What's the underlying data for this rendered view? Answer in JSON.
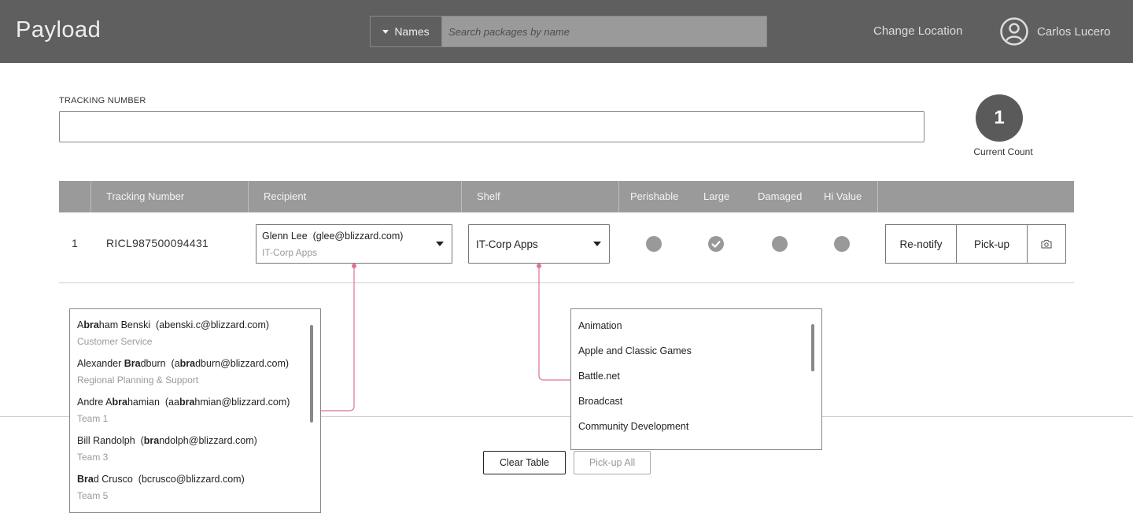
{
  "app": {
    "title": "Payload"
  },
  "header": {
    "search": {
      "mode_label": "Names",
      "placeholder": "Search packages by name"
    },
    "change_location": "Change Location",
    "user_name": "Carlos Lucero"
  },
  "tracking": {
    "label": "TRACKING NUMBER",
    "value": ""
  },
  "count": {
    "value": "1",
    "label": "Current Count"
  },
  "table": {
    "headers": {
      "tracking": "Tracking Number",
      "recipient": "Recipient",
      "shelf": "Shelf",
      "perishable": "Perishable",
      "large": "Large",
      "damaged": "Damaged",
      "hi_value": "Hi Value"
    },
    "rows": [
      {
        "index": "1",
        "tracking": "RICL987500094431",
        "recipient_name": "Glenn Lee  (glee@blizzard.com)",
        "recipient_team": "IT-Corp Apps",
        "shelf": "IT-Corp Apps",
        "perishable": false,
        "large": true,
        "damaged": false,
        "hi_value": false,
        "actions": {
          "renotify": "Re-notify",
          "pickup": "Pick-up"
        }
      }
    ]
  },
  "recipient_dropdown": {
    "highlight": "bra",
    "options": [
      {
        "parts": [
          "A",
          "bra",
          "ham Benski  (abenski.c@blizzard.com)"
        ],
        "team": "Customer Service"
      },
      {
        "parts": [
          "Alexander ",
          "Bra",
          "dburn  (a",
          "bra",
          "dburn@blizzard.com)"
        ],
        "team": "Regional Planning & Support"
      },
      {
        "parts": [
          "Andre A",
          "bra",
          "hamian  (aa",
          "bra",
          "hmian@blizzard.com)"
        ],
        "team": "Team 1"
      },
      {
        "parts": [
          "Bill Randolph  (",
          "bra",
          "ndolph@blizzard.com)"
        ],
        "team": "Team 3"
      },
      {
        "parts": [
          "",
          "Bra",
          "d Crusco  (bcrusco@blizzard.com)"
        ],
        "team": "Team 5"
      }
    ]
  },
  "shelf_dropdown": {
    "options": [
      "Animation",
      "Apple and Classic Games",
      "Battle.net",
      "Broadcast",
      "Community Development"
    ]
  },
  "footer": {
    "clear_table": "Clear Table",
    "pickup_all": "Pick-up All"
  },
  "colors": {
    "header_bg": "#5f5f5f",
    "table_header_bg": "#9a9a9a",
    "connector": "#e0719a",
    "status_off": "#999999"
  }
}
